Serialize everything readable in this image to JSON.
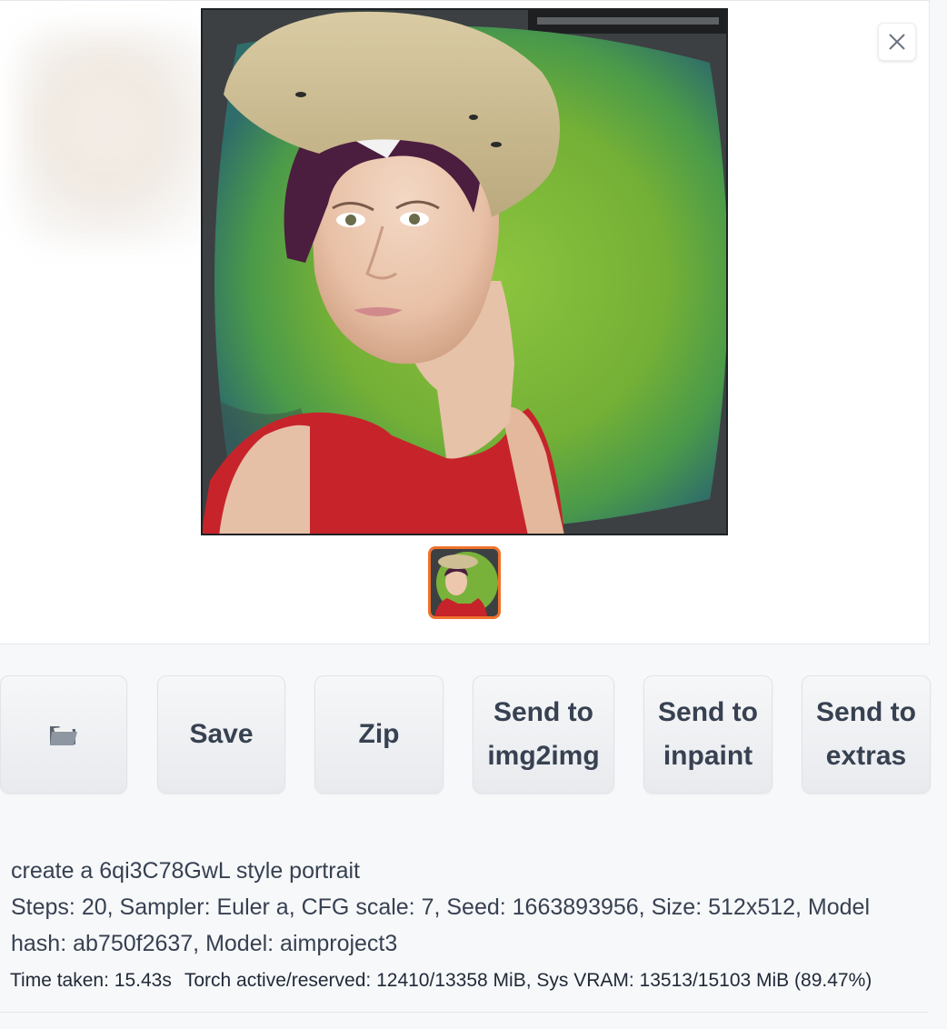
{
  "gallery": {
    "close_label": "×",
    "image_subject": "portrait of a woman with short purple hair wearing a tan hat and red tank top on a green background",
    "thumbnail_selected": true
  },
  "actions": {
    "open_folder_icon": "folder-icon",
    "save_label": "Save",
    "zip_label": "Zip",
    "send_img2img_line1": "Send to",
    "send_img2img_line2": "img2img",
    "send_inpaint_line1": "Send to",
    "send_inpaint_line2": "inpaint",
    "send_extras_line1": "Send to",
    "send_extras_line2": "extras"
  },
  "generation_info": {
    "prompt": "create a 6qi3C78GwL style portrait",
    "params": "Steps: 20, Sampler: Euler a, CFG scale: 7, Seed: 1663893956, Size: 512x512, Model hash: ab750f2637, Model: aimproject3"
  },
  "performance": {
    "time_taken": "Time taken: 15.43s",
    "vram": "Torch active/reserved: 12410/13358 MiB, Sys VRAM: 13513/15103 MiB (89.47%)"
  },
  "colors": {
    "accent_border": "#f0712b",
    "button_text": "#374151",
    "background": "#f7f8fa"
  }
}
